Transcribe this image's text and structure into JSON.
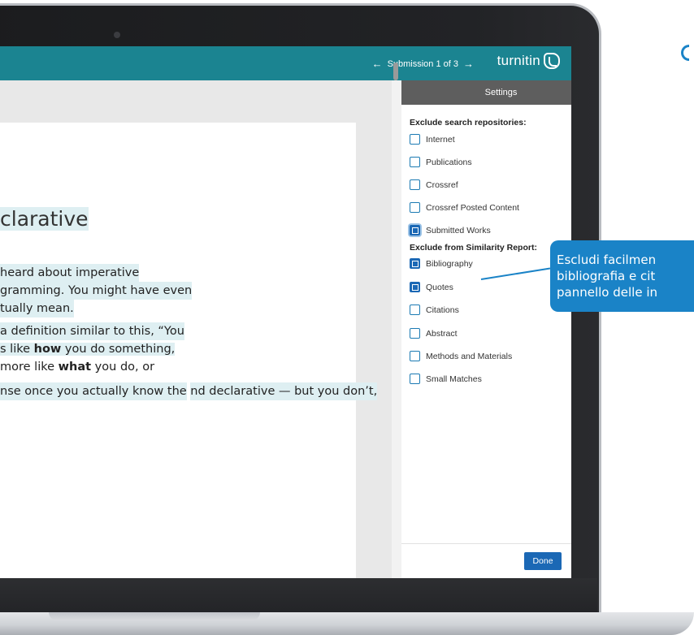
{
  "topbar": {
    "prev_arrow": "←",
    "submission_label": "Submission 1 of 3",
    "next_arrow": "→",
    "brand": "turnitin"
  },
  "document": {
    "heading": "clarative",
    "paragraphs": [
      [
        "heard about imperative",
        "gramming. You might have even",
        "tually mean."
      ],
      [
        "a definition similar to this, “You",
        "s like how you do something,",
        "more like what you do, or"
      ],
      [
        "nse once you actually know the",
        "nd declarative — but you don’t,"
      ]
    ]
  },
  "settings": {
    "title": "Settings",
    "section1_title": "Exclude search repositories:",
    "section1_options": [
      {
        "label": "Internet",
        "checked": false
      },
      {
        "label": "Publications",
        "checked": false
      },
      {
        "label": "Crossref",
        "checked": false
      },
      {
        "label": "Crossref Posted Content",
        "checked": false
      },
      {
        "label": "Submitted Works",
        "checked": true
      }
    ],
    "section2_title": "Exclude from Similarity Report:",
    "section2_options": [
      {
        "label": "Bibliography",
        "checked": true
      },
      {
        "label": "Quotes",
        "checked": true
      },
      {
        "label": "Citations",
        "checked": false
      },
      {
        "label": "Abstract",
        "checked": false
      },
      {
        "label": "Methods and Materials",
        "checked": false
      },
      {
        "label": "Small Matches",
        "checked": false
      }
    ],
    "done_label": "Done"
  },
  "callout": {
    "lines": [
      "Escludi facilmen",
      "bibliografia e cit",
      "pannello delle in"
    ]
  },
  "colors": {
    "topbar": "#1b8491",
    "accent": "#1b68b5",
    "callout": "#1a83c7",
    "highlight": "#deeff2"
  }
}
